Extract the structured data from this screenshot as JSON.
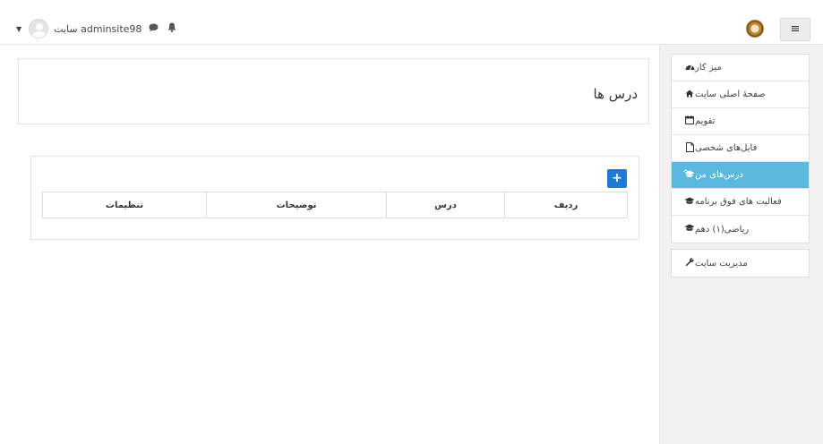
{
  "navbar": {
    "username": "سایت adminsite98",
    "icons": {
      "notifications": "bell-icon",
      "messages": "comment-icon",
      "dropdown": "caret-down-icon",
      "menu": "hamburger-icon"
    }
  },
  "sidebar": {
    "group1": [
      {
        "label": "میز کار",
        "icon": "dashboard-icon"
      },
      {
        "label": "صفحهٔ اصلی سایت",
        "icon": "home-icon"
      },
      {
        "label": "تقویم",
        "icon": "calendar-icon"
      },
      {
        "label": "فایل‌های شخصی",
        "icon": "file-icon"
      },
      {
        "label": "درس‌های من",
        "icon": "graduation-cap-icon",
        "active": true
      },
      {
        "label": "فعالیت های فوق برنامه",
        "icon": "graduation-cap-icon"
      },
      {
        "label": "ریاضی(۱) دهم",
        "icon": "graduation-cap-icon"
      }
    ],
    "group2": [
      {
        "label": "مدیریت سایت",
        "icon": "wrench-icon"
      }
    ]
  },
  "main": {
    "page_title": "درس ها",
    "add_button": "+",
    "table": {
      "headers": [
        "ردیف",
        "درس",
        "توضیحات",
        "تنظیمات"
      ]
    }
  },
  "colors": {
    "active": "#5bb8df",
    "add_button": "#1e7ad8",
    "sidebar_bg": "#f2f2f2"
  }
}
